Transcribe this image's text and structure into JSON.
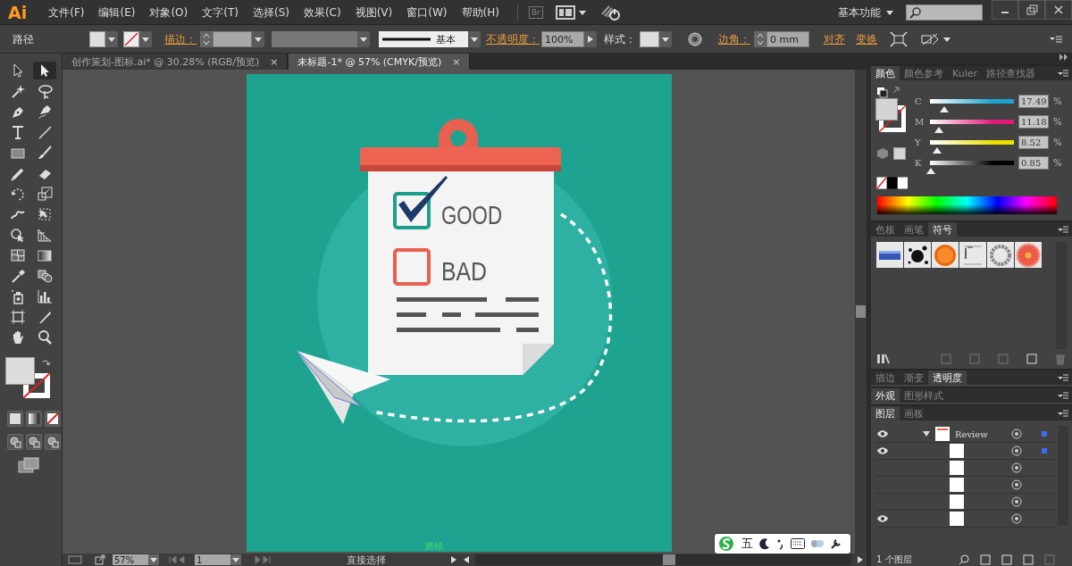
{
  "app": {
    "logo": "Ai"
  },
  "menu": [
    "文件(F)",
    "编辑(E)",
    "对象(O)",
    "文字(T)",
    "选择(S)",
    "效果(C)",
    "视图(V)",
    "窗口(W)",
    "帮助(H)"
  ],
  "bridge": "Br",
  "workspace": "基本功能",
  "control_bar": {
    "selection": "路径",
    "stroke_label": "描边：",
    "stroke_style": "基本",
    "opacity_label": "不透明度：",
    "opacity": "100%",
    "style_label": "样式：",
    "corner_label": "边角：",
    "corner": "0 mm",
    "align": "对齐",
    "transform": "变换"
  },
  "document_tabs": [
    {
      "label": "创作策划-图标.ai* @ 30.28% (RGB/预览)",
      "close": "×",
      "selected": false
    },
    {
      "label": "未标题-1* @ 57% (CMYK/预览)",
      "close": "×",
      "selected": true
    }
  ],
  "tools": [
    {
      "kind": "select",
      "selected": false
    },
    {
      "kind": "direct",
      "selected": true
    },
    {
      "kind": "wand",
      "selected": false
    },
    {
      "kind": "lasso",
      "selected": false
    },
    {
      "kind": "pen",
      "selected": false
    },
    {
      "kind": "curvature",
      "selected": false
    },
    {
      "kind": "type",
      "selected": false
    },
    {
      "kind": "line",
      "selected": false
    },
    {
      "kind": "rect",
      "selected": false
    },
    {
      "kind": "brush",
      "selected": false
    },
    {
      "kind": "pencil",
      "selected": false
    },
    {
      "kind": "eraser",
      "selected": false
    },
    {
      "kind": "rotate",
      "selected": false
    },
    {
      "kind": "scale",
      "selected": false
    },
    {
      "kind": "warp",
      "selected": false
    },
    {
      "kind": "freetransform",
      "selected": false
    },
    {
      "kind": "shapebuilder",
      "selected": false
    },
    {
      "kind": "perspective",
      "selected": false
    },
    {
      "kind": "mesh",
      "selected": false
    },
    {
      "kind": "gradient",
      "selected": false
    },
    {
      "kind": "eyedropper",
      "selected": false
    },
    {
      "kind": "blend",
      "selected": false
    },
    {
      "kind": "sprayer",
      "selected": false
    },
    {
      "kind": "graph",
      "selected": false
    },
    {
      "kind": "artboard",
      "selected": false
    },
    {
      "kind": "knife",
      "selected": false
    },
    {
      "kind": "hand",
      "selected": false
    },
    {
      "kind": "zoom",
      "selected": false
    }
  ],
  "artwork": {
    "checklist": [
      {
        "label": "GOOD",
        "checked": true,
        "color": "#1e9e8c"
      },
      {
        "label": "BAD",
        "checked": false,
        "color": "#e8604f"
      }
    ],
    "hint": "路径"
  },
  "color_panel": {
    "tabs": [
      {
        "label": "颜色",
        "selected": true
      },
      {
        "label": "颜色参考",
        "selected": false
      },
      {
        "label": "Kuler",
        "selected": false
      },
      {
        "label": "路径查找器",
        "selected": false
      }
    ],
    "channels": [
      {
        "name": "C",
        "level": 0.17,
        "reading": "17.49",
        "unit": "%",
        "color": "#1aa3d0"
      },
      {
        "name": "M",
        "level": 0.11,
        "reading": "11.18",
        "unit": "%",
        "color": "#e0197a"
      },
      {
        "name": "Y",
        "level": 0.085,
        "reading": "8.52",
        "unit": "%",
        "color": "#ece000"
      },
      {
        "name": "K",
        "level": 0.01,
        "reading": "0.85",
        "unit": "%",
        "color": "#000000"
      }
    ]
  },
  "symbols_panel": {
    "tabs": [
      {
        "label": "色板",
        "selected": false
      },
      {
        "label": "画笔",
        "selected": false
      },
      {
        "label": "符号",
        "selected": true
      }
    ]
  },
  "stroke_panel": {
    "tabs": [
      {
        "label": "描边",
        "selected": false
      },
      {
        "label": "渐变",
        "selected": false
      },
      {
        "label": "透明度",
        "selected": true
      }
    ]
  },
  "appearance_panel": {
    "tabs": [
      {
        "label": "外观",
        "selected": true
      },
      {
        "label": "图形样式",
        "selected": false
      }
    ]
  },
  "layers_panel": {
    "tabs": [
      {
        "label": "图层",
        "selected": true
      },
      {
        "label": "画板",
        "selected": false
      }
    ],
    "layers": [
      {
        "name": "Review",
        "expanded": true
      }
    ],
    "count": "1 个图层"
  },
  "status_bar": {
    "zoom": "57%",
    "artboard": "1",
    "tool": "直接选择"
  },
  "ime_bar": {
    "mode": "五"
  }
}
